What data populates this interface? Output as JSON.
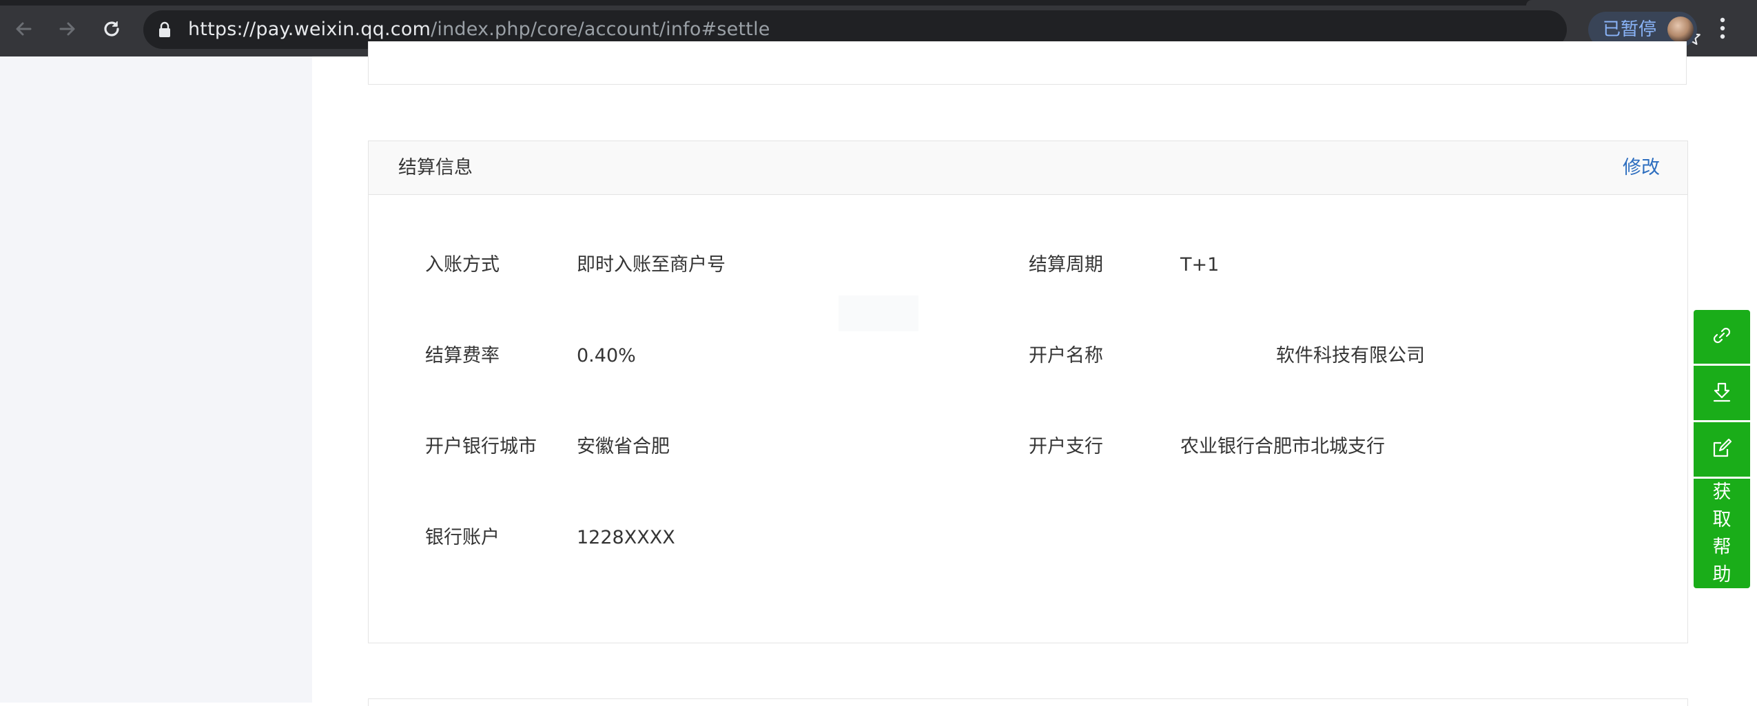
{
  "browser": {
    "url_host": "https://pay.weixin.qq.com",
    "url_path": "/index.php/core/account/info#settle",
    "profile_label": "已暂停",
    "icons": [
      "back-icon",
      "forward-icon",
      "reload-icon",
      "lock-icon",
      "star-icon",
      "avatar",
      "menu-icon"
    ]
  },
  "settle": {
    "title": "结算信息",
    "edit_label": "修改",
    "fields": [
      {
        "label": "入账方式",
        "value": "即时入账至商户号"
      },
      {
        "label": "结算周期",
        "value": "T+1"
      },
      {
        "label": "结算费率",
        "value": "0.40%"
      },
      {
        "label": "开户名称",
        "value": "软件科技有限公司"
      },
      {
        "label": "开户银行城市",
        "value": "安徽省合肥"
      },
      {
        "label": "开户支行",
        "value": "农业银行合肥市北城支行"
      },
      {
        "label": "银行账户",
        "value": "1228XXXX"
      }
    ]
  },
  "float_tools": {
    "icons": [
      "link-icon",
      "download-icon",
      "edit-icon"
    ],
    "help_label": "获取帮助"
  },
  "colors": {
    "chrome_bg": "#35363a",
    "sidebar_bg": "#f4f5f9",
    "link": "#2d6ebf",
    "tool_green": "#1aad19"
  }
}
